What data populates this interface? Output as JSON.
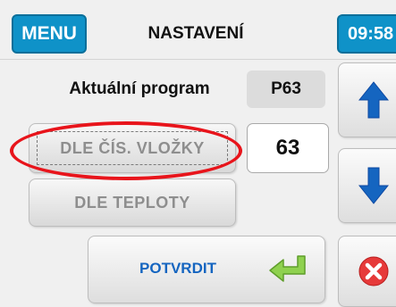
{
  "header": {
    "menu_label": "MENU",
    "title": "NASTAVENÍ",
    "time": "09:58"
  },
  "program": {
    "label": "Aktuální program",
    "value": "P63"
  },
  "options": {
    "by_insert_label": "DLE ČÍS. VLOŽKY",
    "by_temperature_label": "DLE TEPLOTY"
  },
  "number_field": {
    "value": "63"
  },
  "actions": {
    "confirm_label": "POTVRDIT"
  },
  "icons": {
    "up": "up-arrow-icon",
    "down": "down-arrow-icon",
    "confirm": "return-arrow-icon",
    "cancel": "close-icon"
  },
  "colors": {
    "accent_blue": "#0f92c8",
    "arrow_blue": "#1565c0",
    "highlight_red": "#e8141b",
    "confirm_green": "#8fd14f",
    "cancel_red": "#e63a3a"
  }
}
